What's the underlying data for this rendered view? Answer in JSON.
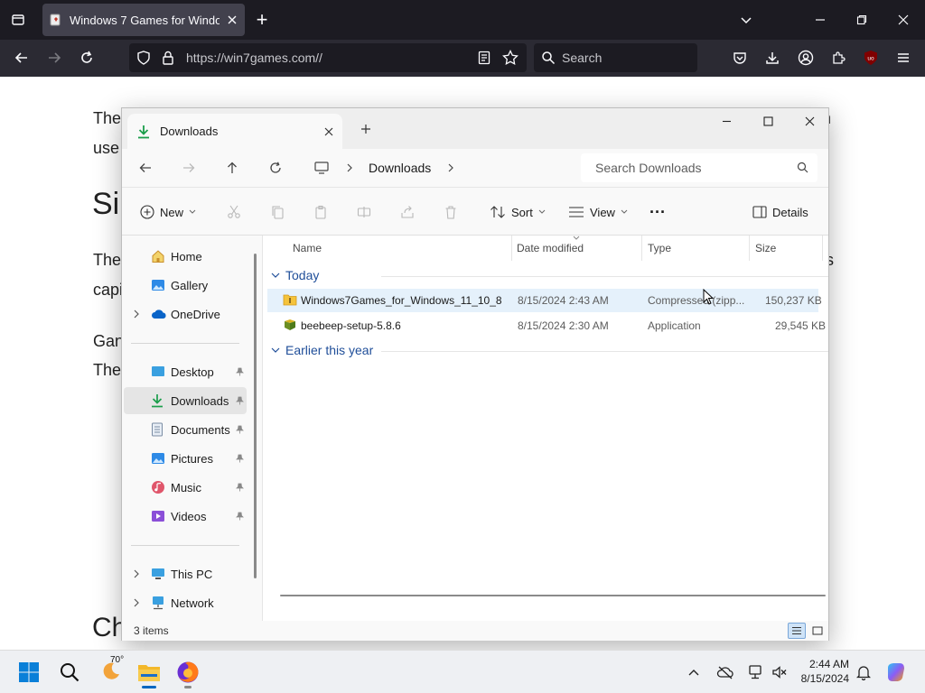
{
  "browser": {
    "tab_title": "Windows 7 Games for Window",
    "new_tab_symbol": "+",
    "url": "https://win7games.com//",
    "search_placeholder": "Search",
    "addon_badge": "uo"
  },
  "page_behind": {
    "lines": [
      "The",
      "use",
      "Si",
      "The",
      "capi",
      "Gan",
      "The",
      "Ch"
    ],
    "right_fragments": [
      "n",
      "s",
      "."
    ]
  },
  "explorer": {
    "tab_label": "Downloads",
    "breadcrumb": "Downloads",
    "search_placeholder": "Search Downloads",
    "commands": {
      "new": "New",
      "sort": "Sort",
      "view": "View",
      "more": "···",
      "details": "Details"
    },
    "sidebar": [
      {
        "label": "Home",
        "icon": "home-icon",
        "pinned": false
      },
      {
        "label": "Gallery",
        "icon": "gallery-icon",
        "pinned": false
      },
      {
        "label": "OneDrive",
        "icon": "cloud-icon",
        "pinned": false
      },
      {
        "label": "Desktop",
        "icon": "desktop-icon",
        "pinned": true
      },
      {
        "label": "Downloads",
        "icon": "download-icon",
        "pinned": true
      },
      {
        "label": "Documents",
        "icon": "documents-icon",
        "pinned": true
      },
      {
        "label": "Pictures",
        "icon": "pictures-icon",
        "pinned": true
      },
      {
        "label": "Music",
        "icon": "music-icon",
        "pinned": true
      },
      {
        "label": "Videos",
        "icon": "videos-icon",
        "pinned": true
      },
      {
        "label": "This PC",
        "icon": "pc-icon",
        "pinned": false
      },
      {
        "label": "Network",
        "icon": "network-icon",
        "pinned": false
      }
    ],
    "columns": [
      "Name",
      "Date modified",
      "Type",
      "Size"
    ],
    "groups": [
      {
        "label": "Today",
        "files": [
          {
            "name": "Windows7Games_for_Windows_11_10_8",
            "date": "8/15/2024 2:43 AM",
            "type": "Compressed (zipp...",
            "size": "150,237 KB"
          },
          {
            "name": "beebeep-setup-5.8.6",
            "date": "8/15/2024 2:30 AM",
            "type": "Application",
            "size": "29,545 KB"
          }
        ]
      },
      {
        "label": "Earlier this year",
        "files": []
      }
    ],
    "status": "3 items"
  },
  "taskbar": {
    "weather": "70°",
    "time": "2:44 AM",
    "date": "8/15/2024"
  },
  "colors": {
    "accent": "#0067c0",
    "browser_dark": "#1c1b22",
    "selected_row": "#e5f1fb"
  }
}
